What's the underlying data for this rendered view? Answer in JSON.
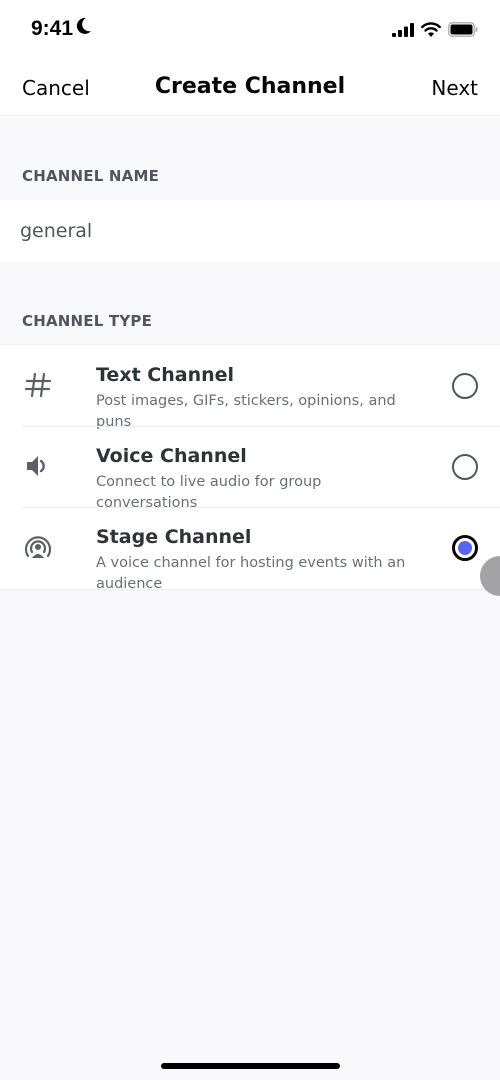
{
  "status_bar": {
    "time": "9:41",
    "icons": [
      "moon-icon",
      "cellular-signal-icon",
      "wifi-icon",
      "battery-icon"
    ]
  },
  "nav": {
    "cancel_label": "Cancel",
    "title": "Create Channel",
    "next_label": "Next"
  },
  "channel_name": {
    "header": "CHANNEL NAME",
    "value": "general",
    "placeholder": ""
  },
  "channel_type": {
    "header": "CHANNEL TYPE",
    "items": [
      {
        "icon": "hash-icon",
        "title": "Text Channel",
        "description": "Post images, GIFs, stickers, opinions, and puns",
        "selected": false
      },
      {
        "icon": "speaker-icon",
        "title": "Voice Channel",
        "description": "Connect to live audio for group conversations",
        "selected": false
      },
      {
        "icon": "stage-icon",
        "title": "Stage Channel",
        "description": "A voice channel for hosting events with an audience",
        "selected": true
      }
    ]
  },
  "colors": {
    "accent": "#5865f2",
    "background": "#f9f9fb",
    "surface": "#ffffff",
    "text_primary": "#2e3338",
    "text_secondary": "#6a6f77"
  }
}
